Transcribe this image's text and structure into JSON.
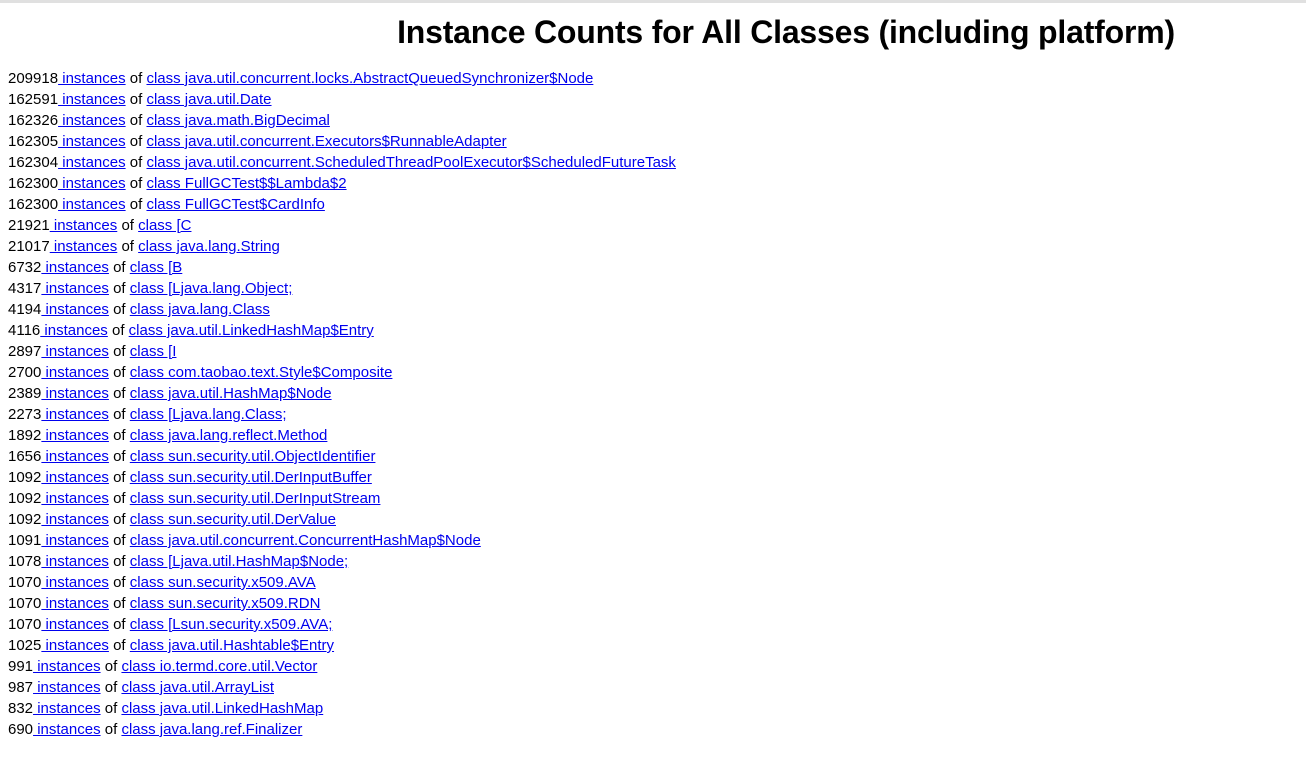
{
  "page": {
    "title": "Instance Counts for All Classes (including platform)",
    "background_color": "#ffffff",
    "text_color": "#000000",
    "link_color": "#0000ee",
    "row_connector": "of",
    "instances_link_label": "instances"
  },
  "rows": [
    {
      "count": "209918",
      "instances_label": " instances",
      "connector": "of",
      "class_label": "class java.util.concurrent.locks.AbstractQueuedSynchronizer$Node"
    },
    {
      "count": "162591",
      "instances_label": " instances",
      "connector": "of",
      "class_label": "class java.util.Date"
    },
    {
      "count": "162326",
      "instances_label": " instances",
      "connector": "of",
      "class_label": "class java.math.BigDecimal"
    },
    {
      "count": "162305",
      "instances_label": " instances",
      "connector": "of",
      "class_label": "class java.util.concurrent.Executors$RunnableAdapter"
    },
    {
      "count": "162304",
      "instances_label": " instances",
      "connector": "of",
      "class_label": "class java.util.concurrent.ScheduledThreadPoolExecutor$ScheduledFutureTask"
    },
    {
      "count": "162300",
      "instances_label": " instances",
      "connector": "of",
      "class_label": "class FullGCTest$$Lambda$2"
    },
    {
      "count": "162300",
      "instances_label": " instances",
      "connector": "of",
      "class_label": "class FullGCTest$CardInfo"
    },
    {
      "count": "21921",
      "instances_label": " instances",
      "connector": "of",
      "class_label": "class [C"
    },
    {
      "count": "21017",
      "instances_label": " instances",
      "connector": "of",
      "class_label": "class java.lang.String"
    },
    {
      "count": "6732",
      "instances_label": " instances",
      "connector": "of",
      "class_label": "class [B"
    },
    {
      "count": "4317",
      "instances_label": " instances",
      "connector": "of",
      "class_label": "class [Ljava.lang.Object;"
    },
    {
      "count": "4194",
      "instances_label": " instances",
      "connector": "of",
      "class_label": "class java.lang.Class"
    },
    {
      "count": "4116",
      "instances_label": " instances",
      "connector": "of",
      "class_label": "class java.util.LinkedHashMap$Entry"
    },
    {
      "count": "2897",
      "instances_label": " instances",
      "connector": "of",
      "class_label": "class [I"
    },
    {
      "count": "2700",
      "instances_label": " instances",
      "connector": "of",
      "class_label": "class com.taobao.text.Style$Composite"
    },
    {
      "count": "2389",
      "instances_label": " instances",
      "connector": "of",
      "class_label": "class java.util.HashMap$Node"
    },
    {
      "count": "2273",
      "instances_label": " instances",
      "connector": "of",
      "class_label": "class [Ljava.lang.Class;"
    },
    {
      "count": "1892",
      "instances_label": " instances",
      "connector": "of",
      "class_label": "class java.lang.reflect.Method"
    },
    {
      "count": "1656",
      "instances_label": " instances",
      "connector": "of",
      "class_label": "class sun.security.util.ObjectIdentifier"
    },
    {
      "count": "1092",
      "instances_label": " instances",
      "connector": "of",
      "class_label": "class sun.security.util.DerInputBuffer"
    },
    {
      "count": "1092",
      "instances_label": " instances",
      "connector": "of",
      "class_label": "class sun.security.util.DerInputStream"
    },
    {
      "count": "1092",
      "instances_label": " instances",
      "connector": "of",
      "class_label": "class sun.security.util.DerValue"
    },
    {
      "count": "1091",
      "instances_label": " instances",
      "connector": "of",
      "class_label": "class java.util.concurrent.ConcurrentHashMap$Node"
    },
    {
      "count": "1078",
      "instances_label": " instances",
      "connector": "of",
      "class_label": "class [Ljava.util.HashMap$Node;"
    },
    {
      "count": "1070",
      "instances_label": " instances",
      "connector": "of",
      "class_label": "class sun.security.x509.AVA"
    },
    {
      "count": "1070",
      "instances_label": " instances",
      "connector": "of",
      "class_label": "class sun.security.x509.RDN"
    },
    {
      "count": "1070",
      "instances_label": " instances",
      "connector": "of",
      "class_label": "class [Lsun.security.x509.AVA;"
    },
    {
      "count": "1025",
      "instances_label": " instances",
      "connector": "of",
      "class_label": "class java.util.Hashtable$Entry"
    },
    {
      "count": "991",
      "instances_label": " instances",
      "connector": "of",
      "class_label": "class io.termd.core.util.Vector"
    },
    {
      "count": "987",
      "instances_label": " instances",
      "connector": "of",
      "class_label": "class java.util.ArrayList"
    },
    {
      "count": "832",
      "instances_label": " instances",
      "connector": "of",
      "class_label": "class java.util.LinkedHashMap"
    },
    {
      "count": "690",
      "instances_label": " instances",
      "connector": "of",
      "class_label": "class java.lang.ref.Finalizer"
    }
  ]
}
